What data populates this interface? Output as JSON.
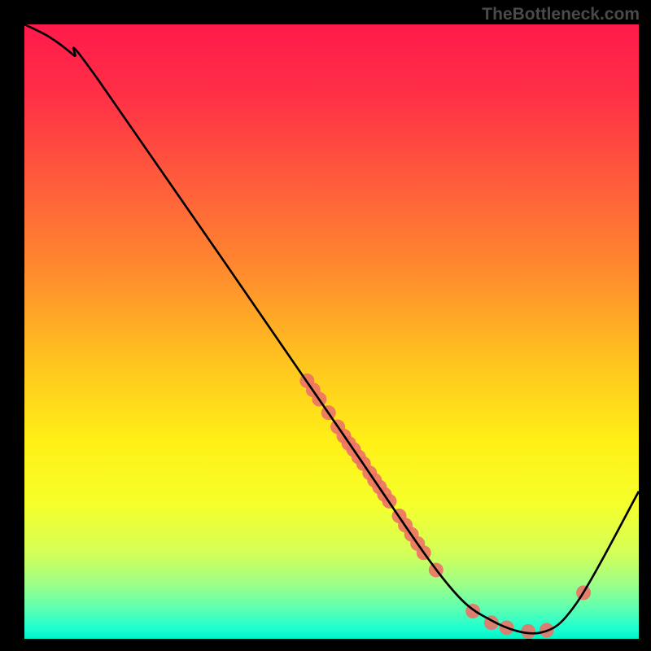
{
  "watermark": "TheBottleneck.com",
  "chart_data": {
    "type": "line",
    "title": "",
    "xlabel": "",
    "ylabel": "",
    "xlim": [
      0,
      100
    ],
    "ylim": [
      0,
      100
    ],
    "grid": false,
    "curve": {
      "x": [
        0,
        4,
        8,
        12,
        50,
        68,
        76,
        84,
        90,
        100
      ],
      "y": [
        100,
        98,
        95,
        91,
        36,
        10,
        3,
        1,
        6,
        24
      ]
    },
    "scatter_points": [
      {
        "x": 46.0,
        "y": 42.0
      },
      {
        "x": 47.0,
        "y": 40.5
      },
      {
        "x": 48.0,
        "y": 39.0
      },
      {
        "x": 49.5,
        "y": 36.8
      },
      {
        "x": 51.0,
        "y": 34.5
      },
      {
        "x": 52.0,
        "y": 33.0
      },
      {
        "x": 52.8,
        "y": 31.8
      },
      {
        "x": 53.6,
        "y": 30.8
      },
      {
        "x": 54.4,
        "y": 29.6
      },
      {
        "x": 55.2,
        "y": 28.5
      },
      {
        "x": 56.2,
        "y": 27.0
      },
      {
        "x": 57.0,
        "y": 25.8
      },
      {
        "x": 57.8,
        "y": 24.7
      },
      {
        "x": 58.6,
        "y": 23.5
      },
      {
        "x": 59.4,
        "y": 22.4
      },
      {
        "x": 61.0,
        "y": 20.0
      },
      {
        "x": 62.0,
        "y": 18.5
      },
      {
        "x": 63.0,
        "y": 17.0
      },
      {
        "x": 64.0,
        "y": 15.5
      },
      {
        "x": 65.0,
        "y": 14.0
      },
      {
        "x": 67.0,
        "y": 11.2
      },
      {
        "x": 73.0,
        "y": 4.5
      },
      {
        "x": 76.0,
        "y": 2.6
      },
      {
        "x": 78.5,
        "y": 1.8
      },
      {
        "x": 82.0,
        "y": 1.2
      },
      {
        "x": 85.0,
        "y": 1.4
      },
      {
        "x": 91.0,
        "y": 7.5
      }
    ],
    "scatter_point_radius_px": 9,
    "scatter_point_color": "#ec7265",
    "curve_color": "#000000",
    "gradient_stops": [
      {
        "pos": 0.0,
        "color": "#ff1a4b"
      },
      {
        "pos": 0.12,
        "color": "#ff3146"
      },
      {
        "pos": 0.25,
        "color": "#ff5a3c"
      },
      {
        "pos": 0.4,
        "color": "#ff8a2e"
      },
      {
        "pos": 0.55,
        "color": "#ffc41f"
      },
      {
        "pos": 0.68,
        "color": "#fff016"
      },
      {
        "pos": 0.78,
        "color": "#f6ff2a"
      },
      {
        "pos": 0.86,
        "color": "#d4ff57"
      },
      {
        "pos": 0.91,
        "color": "#9eff87"
      },
      {
        "pos": 0.95,
        "color": "#5effb0"
      },
      {
        "pos": 0.985,
        "color": "#1affd2"
      },
      {
        "pos": 1.0,
        "color": "#00f2c8"
      }
    ]
  }
}
